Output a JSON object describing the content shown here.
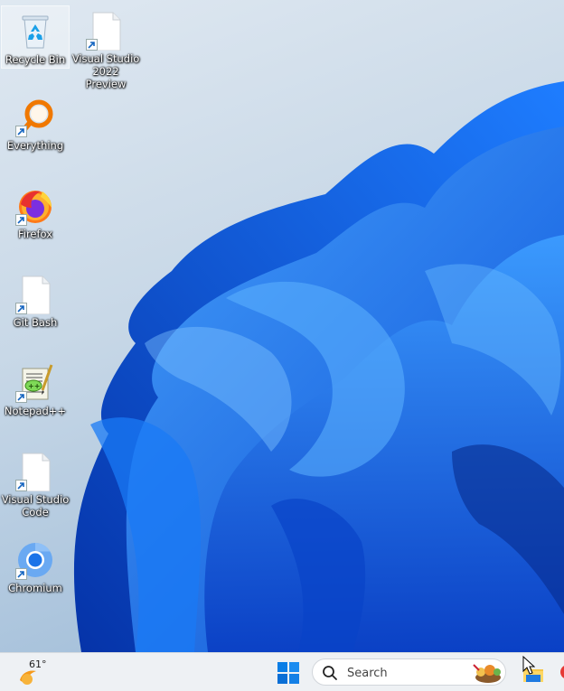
{
  "desktop": {
    "icons": [
      {
        "name": "recycle-bin",
        "label": "Recycle Bin",
        "icon": "recycle-bin-icon",
        "selected": true
      },
      {
        "name": "visual-studio-2022-preview",
        "label": "Visual Studio\n2022 Preview",
        "icon": "blank-file-icon"
      },
      {
        "name": "everything",
        "label": "Everything",
        "icon": "magnifier-icon"
      },
      {
        "name": "firefox",
        "label": "Firefox",
        "icon": "firefox-icon"
      },
      {
        "name": "git-bash",
        "label": "Git Bash",
        "icon": "blank-file-icon"
      },
      {
        "name": "notepad-plus-plus",
        "label": "Notepad++",
        "icon": "notepadpp-icon"
      },
      {
        "name": "visual-studio-code",
        "label": "Visual Studio\nCode",
        "icon": "blank-file-icon"
      },
      {
        "name": "chromium",
        "label": "Chromium",
        "icon": "chromium-icon"
      }
    ]
  },
  "taskbar": {
    "weather": {
      "temp": "61°",
      "icon": "sun-weather-icon"
    },
    "start_icon": "windows-logo-icon",
    "search": {
      "placeholder": "Search"
    },
    "pinned": [
      "file-explorer-icon"
    ]
  },
  "colors": {
    "accent": "#0a63e6",
    "wallpaper_dark": "#0a3fc4",
    "wallpaper_light": "#2f8cff",
    "taskbar": "#eef1f4"
  }
}
